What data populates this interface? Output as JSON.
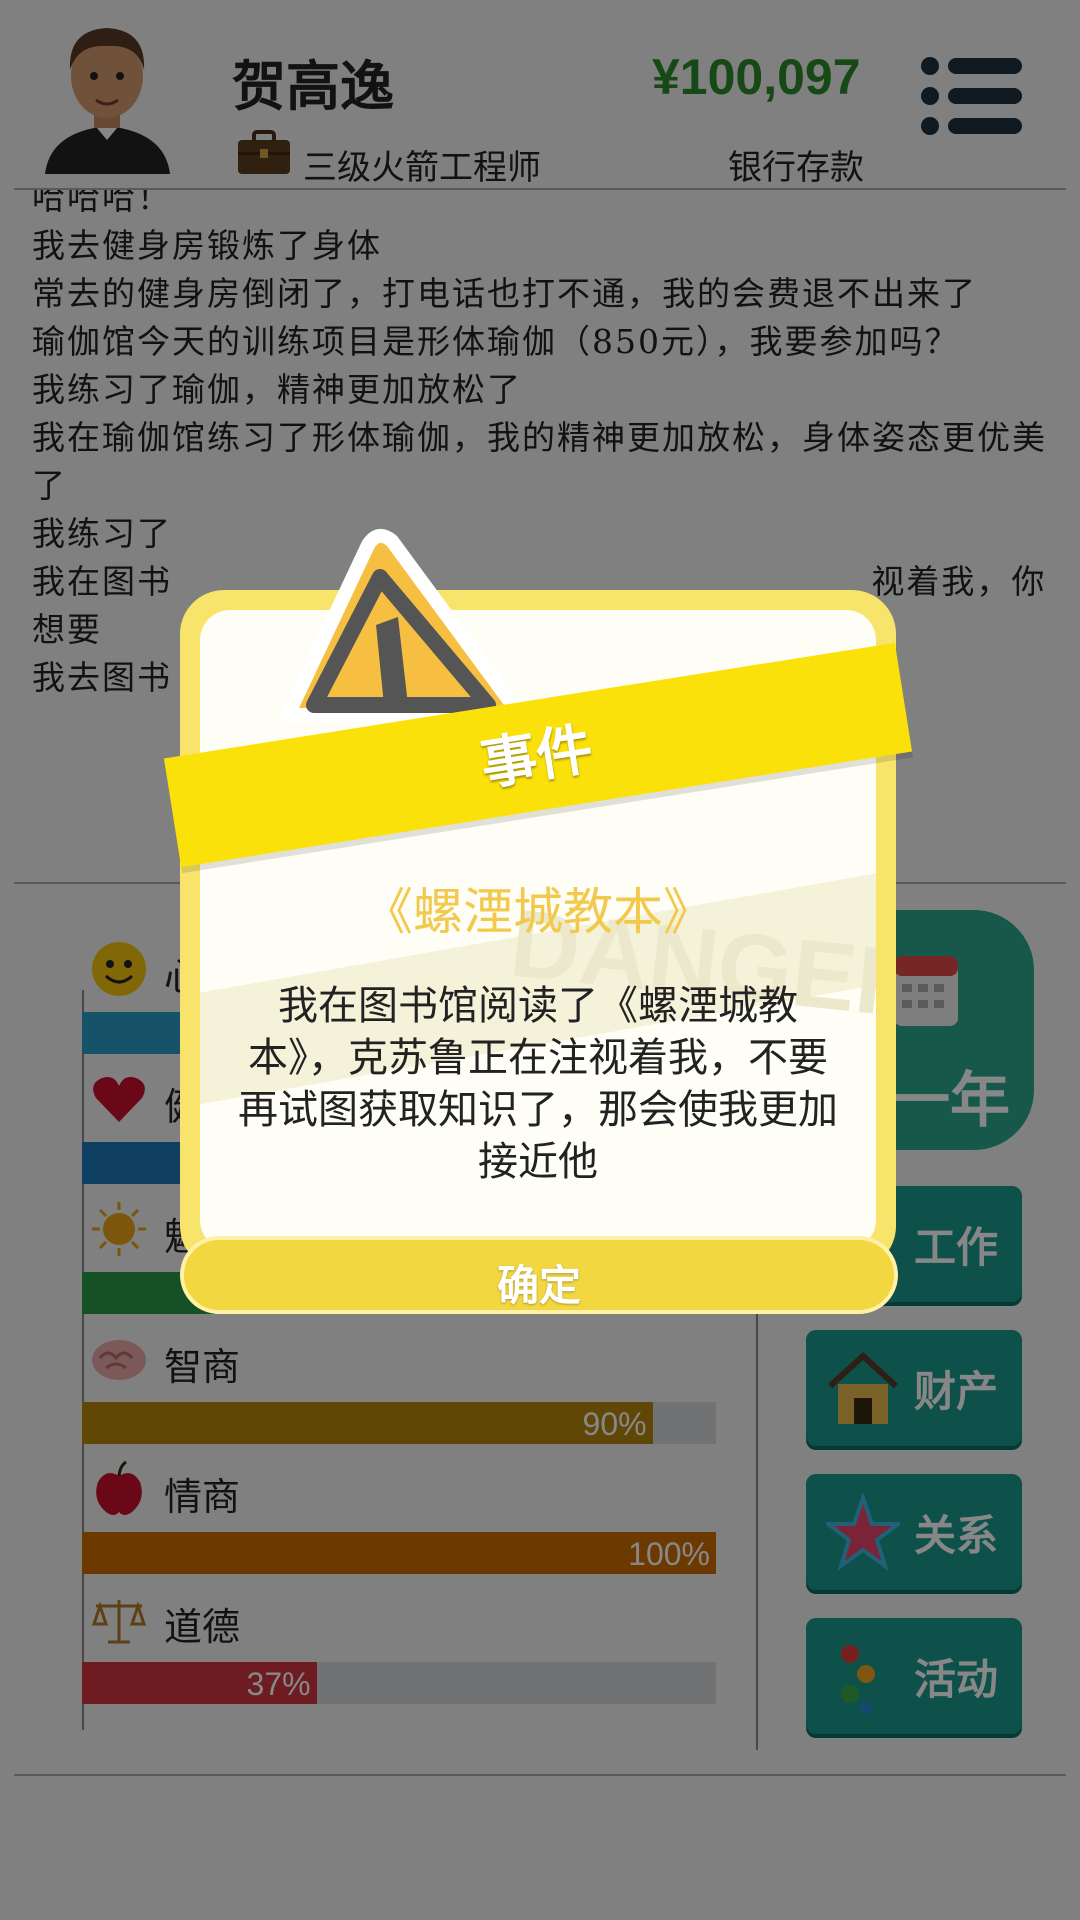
{
  "header": {
    "name": "贺高逸",
    "job": "三级火箭工程师",
    "money": "¥100,097",
    "money_label": "银行存款"
  },
  "log": [
    "哈哈哈！",
    "我去健身房锻炼了身体",
    "常去的健身房倒闭了，打电话也打不通，我的会费退不出来了",
    "瑜伽馆今天的训练项目是形体瑜伽（850元），我要参加吗？",
    "我练习了瑜伽，精神更加放松了",
    "我在瑜伽馆练习了形体瑜伽，我的精神更加放松，身体姿态更优美了",
    "我练习了",
    "我在图书                                                        视着我，你想要",
    "我去图书"
  ],
  "stats": [
    {
      "label": "心",
      "value": 80,
      "color": "#2a9cc4",
      "icon": "smiley-icon"
    },
    {
      "label": "健",
      "value": 70,
      "color": "#1d78b8",
      "icon": "heart-icon"
    },
    {
      "label": "魅",
      "value": 60,
      "color": "#2b9a46",
      "icon": "sun-icon"
    },
    {
      "label": "智商",
      "value": 90,
      "text": "90%",
      "color": "#b8860b",
      "icon": "brain-icon"
    },
    {
      "label": "情商",
      "value": 100,
      "text": "100%",
      "color": "#cc6d00",
      "icon": "apple-icon"
    },
    {
      "label": "道德",
      "value": 37,
      "text": "37%",
      "color": "#d0343f",
      "icon": "scales-icon"
    }
  ],
  "side": {
    "year": "一年",
    "work": "工作",
    "property": "财产",
    "relations": "关系",
    "activity": "活动"
  },
  "dialog": {
    "ribbon": "事件",
    "title": "《螺湮城教本》",
    "body": "我在图书馆阅读了《螺湮城教本》，克苏鲁正在注视着我，不要再试图获取知识了，那会使我更加接近他",
    "ok": "确定",
    "watermark": "DANGER"
  }
}
